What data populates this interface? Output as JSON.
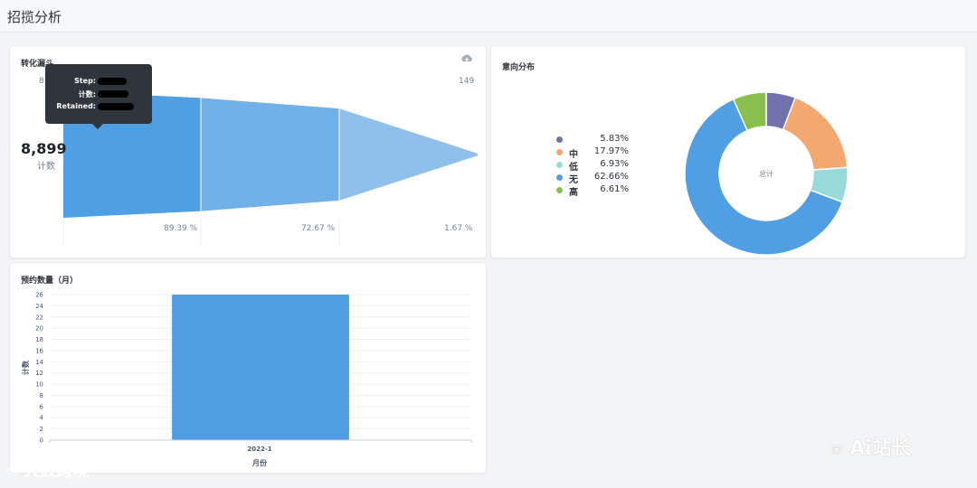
{
  "page": {
    "title": "招揽分析"
  },
  "funnel_card": {
    "title": "转化漏斗",
    "download_icon": "cloud-download-icon",
    "first_step_label": "8",
    "last_step_label": "149",
    "big_value": "8,899",
    "big_label": "计数",
    "percentages": [
      "89.39 %",
      "72.67 %",
      "1.67 %"
    ],
    "tooltip": {
      "step": "Step:",
      "count": "计数:",
      "retained": "Retained:"
    },
    "colors": [
      "#509ee3",
      "#72b0e8",
      "#8fc0ec",
      "#a9cff0"
    ]
  },
  "pie_card": {
    "title": "意向分布",
    "center_label": "总计",
    "legend": [
      {
        "name": "",
        "pct": "5.83%",
        "color": "#7172ad"
      },
      {
        "name": "中",
        "pct": "17.97%",
        "color": "#f2a86f"
      },
      {
        "name": "低",
        "pct": "6.93%",
        "color": "#98d9d9"
      },
      {
        "name": "无",
        "pct": "62.66%",
        "color": "#509ee3"
      },
      {
        "name": "高",
        "pct": "6.61%",
        "color": "#88bf4d"
      }
    ]
  },
  "bar_card": {
    "title": "预约数量（月）",
    "ylabel": "计数",
    "xlabel": "月份",
    "bar_color": "#509ee3"
  },
  "watermarks": {
    "left": "大数跨境",
    "right": "Ai站长"
  },
  "chart_data": [
    {
      "type": "bar",
      "title": "转化漏斗",
      "categories": [
        "",
        "",
        "",
        ""
      ],
      "values": [
        8899,
        7955,
        6467,
        149
      ],
      "percentages": [
        100,
        89.39,
        72.67,
        1.67
      ]
    },
    {
      "type": "pie",
      "title": "意向分布",
      "categories": [
        "",
        "中",
        "低",
        "无",
        "高"
      ],
      "values": [
        5.83,
        17.97,
        6.93,
        62.66,
        6.61
      ],
      "center_label": "总计"
    },
    {
      "type": "bar",
      "title": "预约数量（月）",
      "categories": [
        "2022-1"
      ],
      "values": [
        26
      ],
      "xlabel": "月份",
      "ylabel": "计数",
      "ylim": [
        0,
        26
      ],
      "yticks": [
        0,
        2,
        4,
        6,
        8,
        10,
        12,
        14,
        16,
        18,
        20,
        22,
        24,
        26
      ]
    }
  ]
}
